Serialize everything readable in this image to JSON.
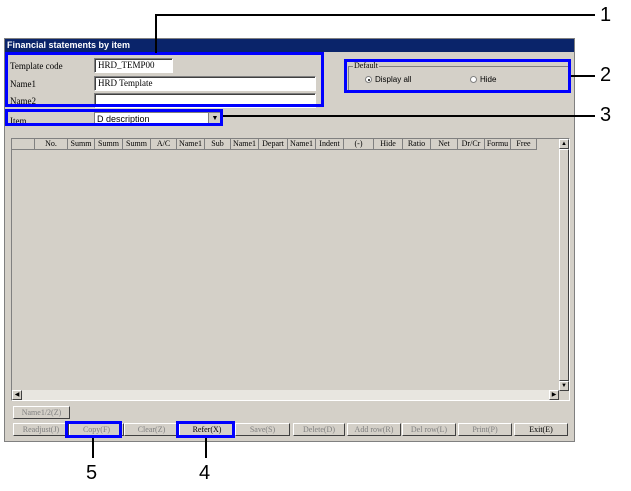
{
  "window": {
    "title": "Financial statements by item"
  },
  "form": {
    "template_code_label": "Template code",
    "template_code_value": "HRD_TEMP00",
    "name1_label": "Name1",
    "name1_value": "HRD Template",
    "name2_label": "Name2",
    "name2_value": "",
    "item_label": "Item",
    "item_value": "D description"
  },
  "default_group": {
    "title": "Default",
    "option_display_all": "Display all",
    "option_hide": "Hide",
    "selected": "Display all"
  },
  "grid": {
    "columns": [
      "",
      "No.",
      "Summ",
      "Summ",
      "Summ",
      "A/C",
      "Name1",
      "Sub",
      "Name1",
      "Depart",
      "Name1",
      "Indent",
      "(-)",
      "Hide",
      "Ratio",
      "Net",
      "Dr/Cr",
      "Formu",
      "Free"
    ]
  },
  "buttons": {
    "name12": "Name1/2(Z)",
    "readjust": "Readjust(J)",
    "copy": "Copy(F)",
    "clear": "Clear(Z)",
    "refer": "Refer(X)",
    "save": "Save(S)",
    "delete": "Delete(D)",
    "add_row": "Add row(R)",
    "del_row": "Del row(L)",
    "print": "Print(P)",
    "exit": "Exit(E)"
  },
  "callouts": {
    "c1": "1",
    "c2": "2",
    "c3": "3",
    "c4": "4",
    "c5": "5"
  },
  "highlight_color": "#0000ff"
}
